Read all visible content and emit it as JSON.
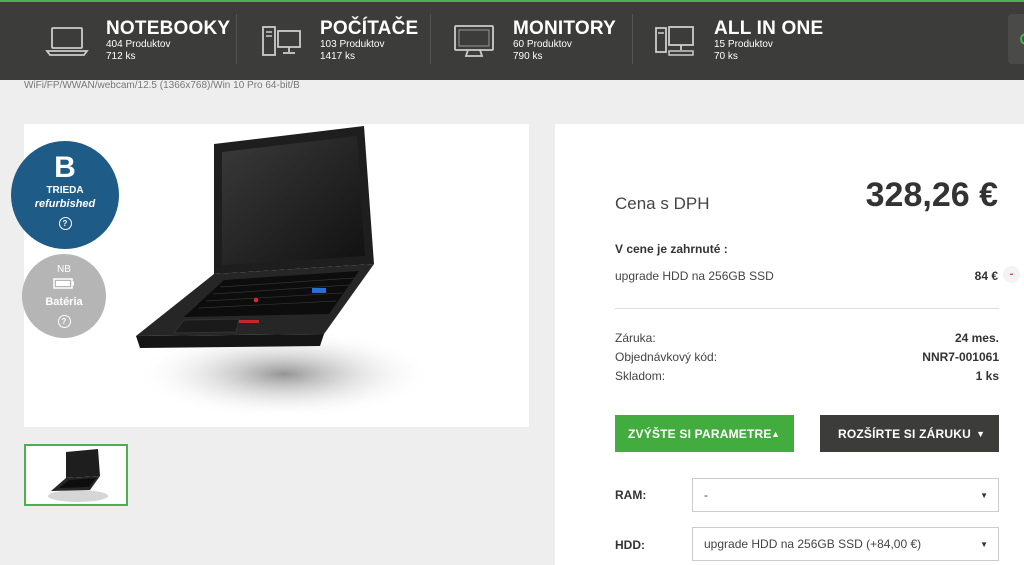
{
  "categories": [
    {
      "title": "NOTEBOOKY",
      "products": "404 Produktov",
      "count": "712 ks",
      "icon": "laptop-icon"
    },
    {
      "title": "POČÍTAČE",
      "products": "103 Produktov",
      "count": "1417 ks",
      "icon": "desktop-pc-icon"
    },
    {
      "title": "MONITORY",
      "products": "60 Produktov",
      "count": "790 ks",
      "icon": "monitor-icon"
    },
    {
      "title": "ALL IN ONE",
      "products": "15 Produktov",
      "count": "70 ks",
      "icon": "all-in-one-icon"
    }
  ],
  "breadcrumb": "WiFi/FP/WWAN/webcam/12.5 (1366x768)/Win 10 Pro 64-bit/B",
  "badges": {
    "grade_letter": "B",
    "grade_label": "TRIEDA",
    "grade_sub": "refurbished",
    "battery_top": "NB",
    "battery_label": "Batéria",
    "help": "?"
  },
  "price": {
    "label": "Cena s DPH",
    "value": "328,26 €"
  },
  "included": {
    "heading": "V cene je zahrnuté :",
    "item": "upgrade HDD na 256GB SSD",
    "item_price": "84 €",
    "remove": "-"
  },
  "info": [
    {
      "label": "Záruka:",
      "value": "24 mes."
    },
    {
      "label": "Objednávkový kód:",
      "value": "NNR7-001061"
    },
    {
      "label": "Skladom:",
      "value": "1 ks"
    }
  ],
  "buttons": {
    "params": "ZVÝŠTE SI PARAMETRE",
    "warranty": "ROZŠÍRTE SI ZÁRUKU"
  },
  "options": {
    "ram_label": "RAM:",
    "ram_value": "-",
    "hdd_label": "HDD:",
    "hdd_value": "upgrade HDD na 256GB SSD (+84,00 €)"
  },
  "colors": {
    "accent_green": "#43ac3f",
    "topbar": "#3c3c3b",
    "badge_blue": "#1e5b87"
  }
}
